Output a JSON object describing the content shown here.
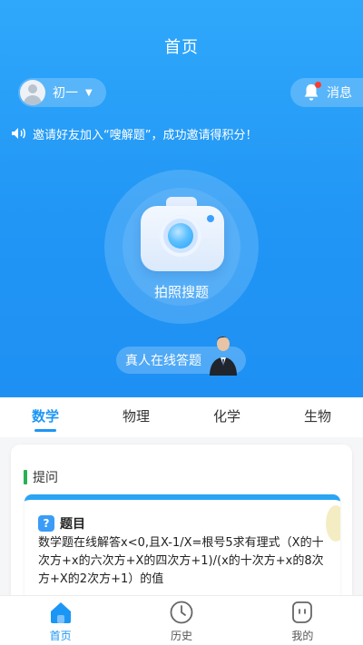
{
  "header": {
    "title": "首页"
  },
  "grade": {
    "label": "初一",
    "caret": "▼"
  },
  "messages": {
    "label": "消息"
  },
  "notice": {
    "text": "邀请好友加入“嗖解题”，成功邀请得积分！"
  },
  "camera": {
    "label": "拍照搜题"
  },
  "live_answer": {
    "label": "真人在线答题"
  },
  "subject_tabs": [
    {
      "label": "数学",
      "active": true
    },
    {
      "label": "物理",
      "active": false
    },
    {
      "label": "化学",
      "active": false
    },
    {
      "label": "生物",
      "active": false
    }
  ],
  "question_card": {
    "header": "提问",
    "icon": "?",
    "title": "题目",
    "text": "数学题在线解答x<0,且X-1/X=根号5求有理式（X的十次方+x的六次方+X的四次方+1)/(x的十次方+x的8次方+X的2次方+1）的值"
  },
  "bottom_nav": [
    {
      "label": "首页",
      "icon": "home-icon",
      "active": true
    },
    {
      "label": "历史",
      "icon": "clock-icon",
      "active": false
    },
    {
      "label": "我的",
      "icon": "profile-face-icon",
      "active": false
    }
  ],
  "colors": {
    "accent": "#1c96f5",
    "hero_top": "#2fa8fb",
    "hero_bottom": "#1e90f4",
    "badge": "#ff3b30",
    "section_bar": "#27b154"
  }
}
